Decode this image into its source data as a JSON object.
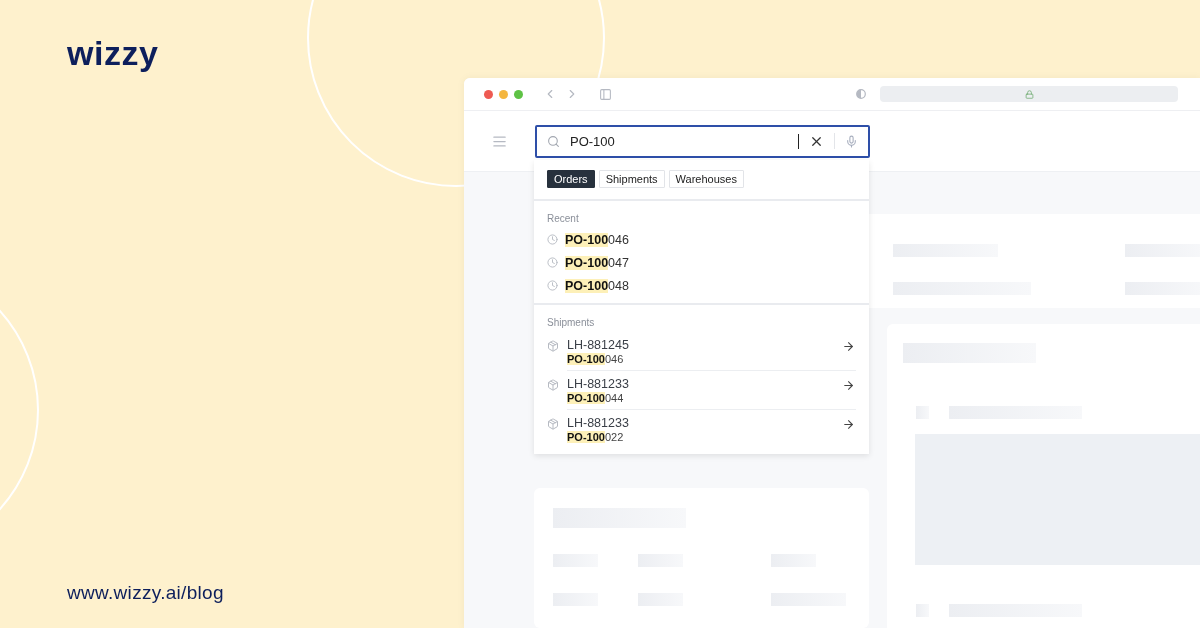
{
  "brand": {
    "logo": "wizzy",
    "url": "www.wizzy.ai/blog"
  },
  "search": {
    "value": "PO-100"
  },
  "filters": [
    {
      "label": "Orders",
      "selected": true
    },
    {
      "label": "Shipments",
      "selected": false
    },
    {
      "label": "Warehouses",
      "selected": false
    }
  ],
  "recent": {
    "title": "Recent",
    "items": [
      "**PO-100**046",
      "**PO-100**047",
      "**PO-100**048"
    ]
  },
  "shipments": {
    "title": "Shipments",
    "items": [
      {
        "id": "LH-881245",
        "order": "**PO-100**046"
      },
      {
        "id": "LH-881233",
        "order": "**PO-100**044"
      },
      {
        "id": "LH-881233",
        "order": "**PO-100**022"
      }
    ]
  }
}
